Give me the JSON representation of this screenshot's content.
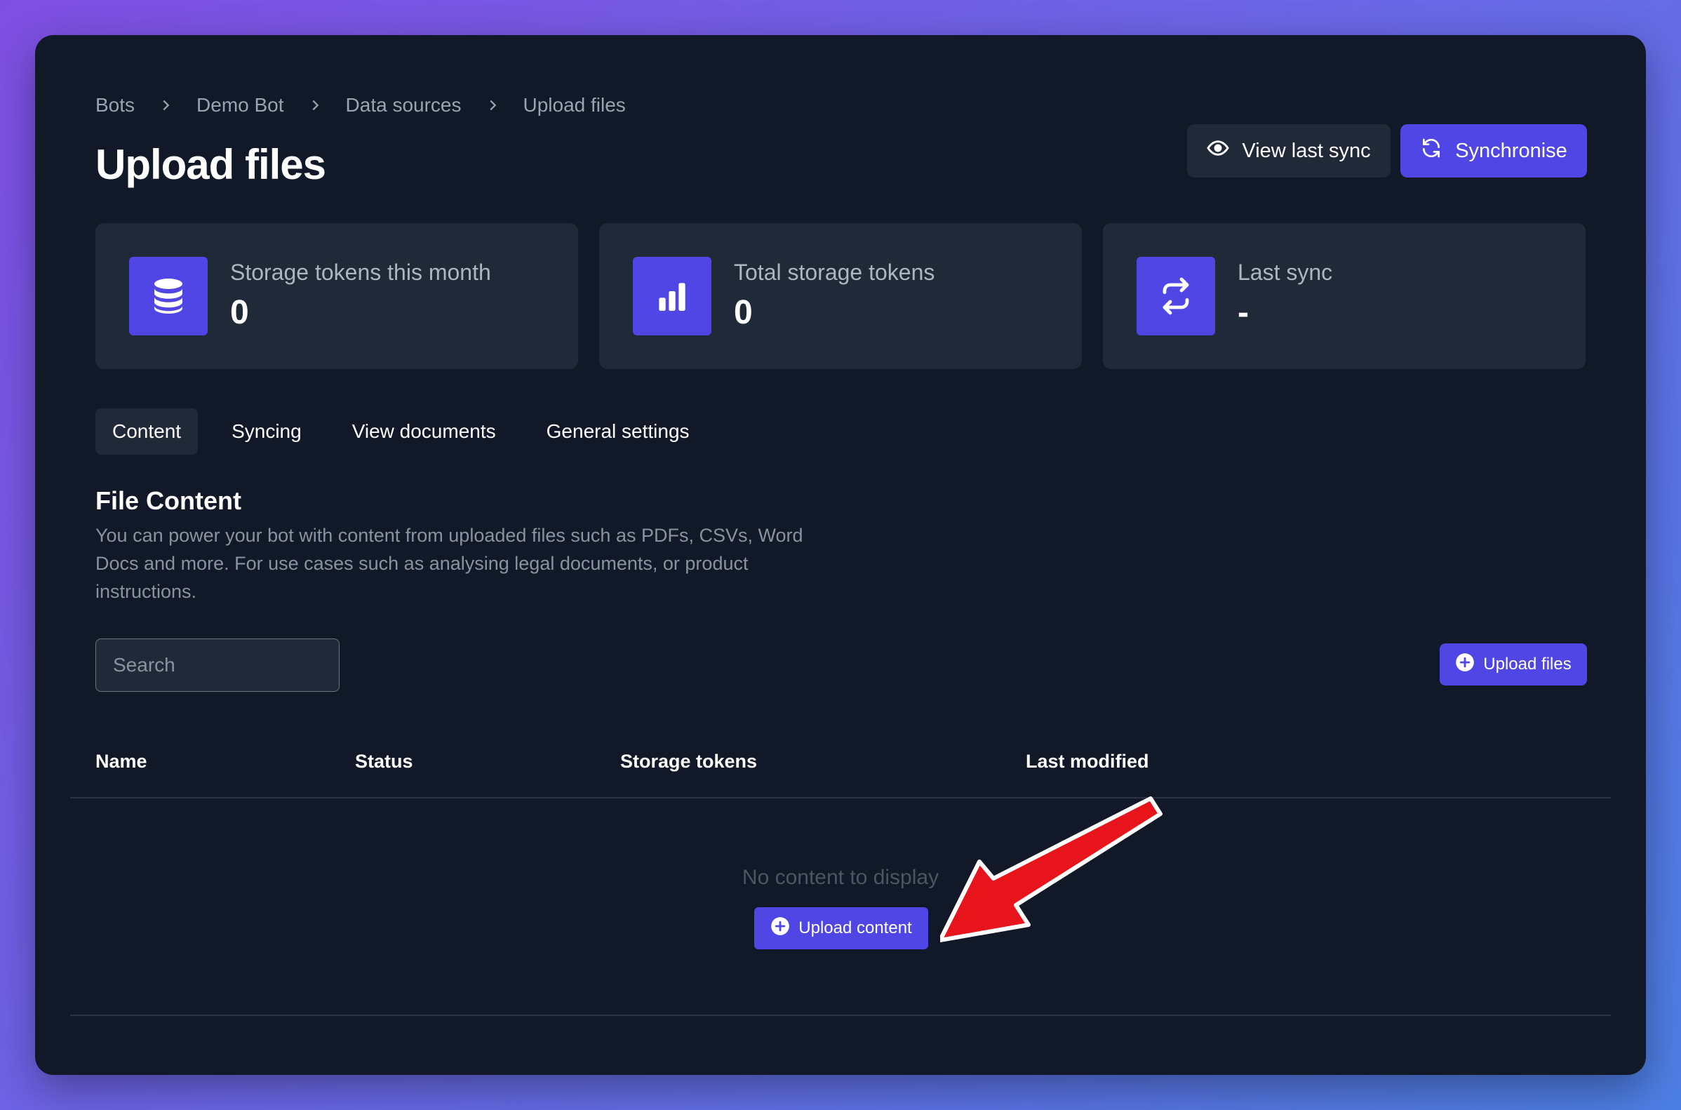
{
  "breadcrumb": [
    "Bots",
    "Demo Bot",
    "Data sources",
    "Upload files"
  ],
  "page_title": "Upload files",
  "header_actions": {
    "view_last_sync": "View last sync",
    "synchronise": "Synchronise"
  },
  "stats": [
    {
      "label": "Storage tokens this month",
      "value": "0",
      "icon": "database-icon"
    },
    {
      "label": "Total storage tokens",
      "value": "0",
      "icon": "bar-chart-icon"
    },
    {
      "label": "Last sync",
      "value": "-",
      "icon": "sync-icon"
    }
  ],
  "tabs": [
    {
      "label": "Content",
      "active": true
    },
    {
      "label": "Syncing",
      "active": false
    },
    {
      "label": "View documents",
      "active": false
    },
    {
      "label": "General settings",
      "active": false
    }
  ],
  "section": {
    "title": "File Content",
    "description": "You can power your bot with content from uploaded files such as PDFs, CSVs, Word Docs and more. For use cases such as analysing legal documents, or product instructions."
  },
  "search": {
    "placeholder": "Search",
    "value": ""
  },
  "upload_files_button": "Upload files",
  "table": {
    "columns": [
      "Name",
      "Status",
      "Storage tokens",
      "Last modified"
    ],
    "rows": []
  },
  "empty_state": {
    "message": "No content to display",
    "button": "Upload content"
  },
  "colors": {
    "background": "#111827",
    "card": "#1f2937",
    "accent": "#4f46e5",
    "annotation_arrow": "#e8141b"
  }
}
